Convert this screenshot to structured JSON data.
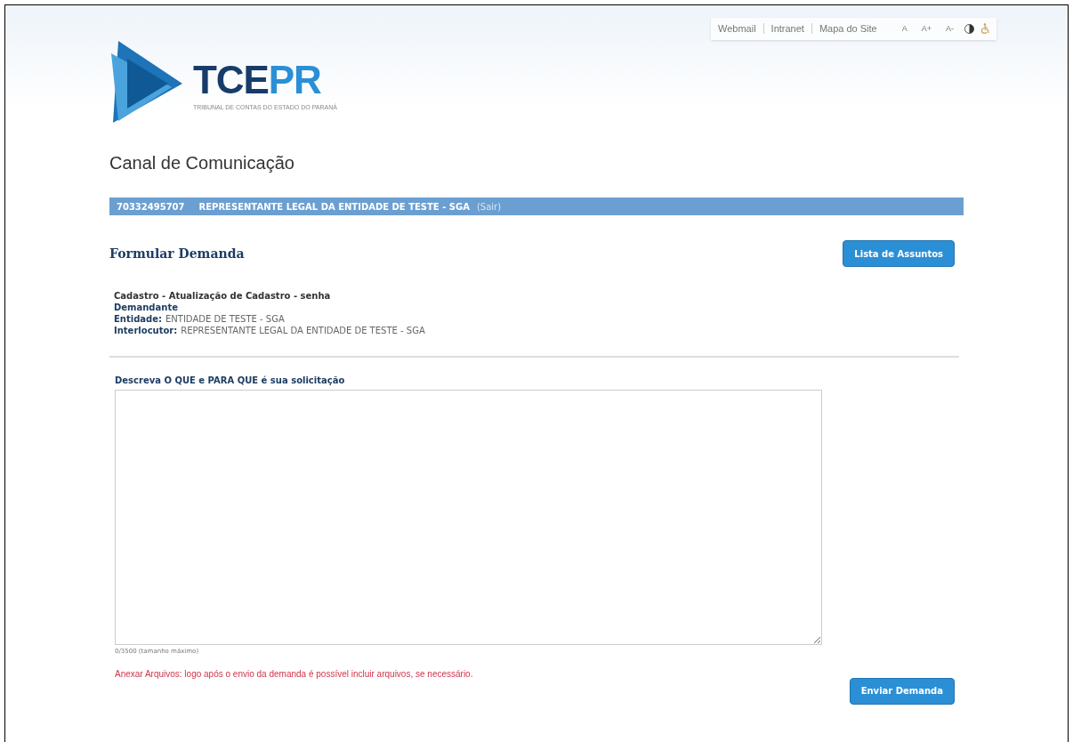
{
  "top_links": [
    "Webmail",
    "Intranet",
    "Mapa do Site"
  ],
  "font_controls": [
    "A",
    "A+",
    "A-"
  ],
  "logo": {
    "text_dark": "TCE",
    "text_light": "PR",
    "tagline": "TRIBUNAL DE CONTAS DO ESTADO DO PARANÁ"
  },
  "page_title": "Canal de Comunicação",
  "user_bar": {
    "code": "70332495707",
    "name": "REPRESENTANTE LEGAL DA ENTIDADE DE TESTE - SGA",
    "logout": "(Sair)"
  },
  "section_title": "Formular Demanda",
  "subjects_button": "Lista de Assuntos",
  "subject": "Cadastro - Atualização de Cadastro - senha",
  "requester_heading": "Demandante",
  "details": [
    {
      "label": "Entidade:",
      "value": "ENTIDADE DE TESTE - SGA"
    },
    {
      "label": "Interlocutor:",
      "value": "REPRESENTANTE LEGAL DA ENTIDADE DE TESTE - SGA"
    }
  ],
  "description_label": "Descreva O QUE e PARA QUE é sua solicitação",
  "char_counter": "0/3500 (tamanho máximo)",
  "attachments_note": "Anexar Arquivos: logo após o envio da demanda é possível incluir arquivos, se necessário.",
  "submit_button": "Enviar Demanda"
}
